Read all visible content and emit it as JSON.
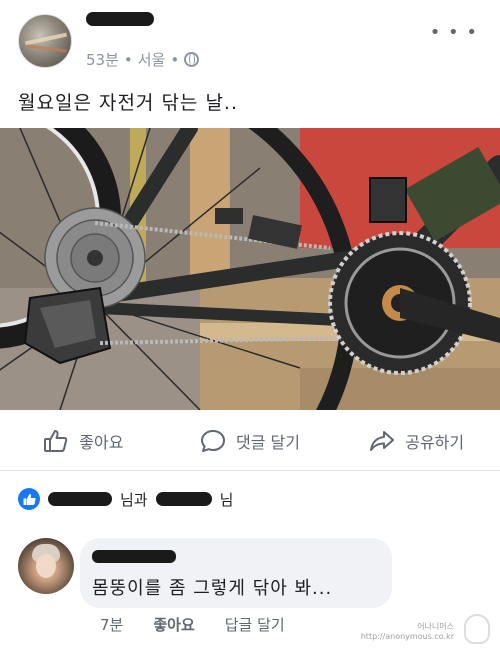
{
  "post": {
    "time": "53분",
    "location": "서울",
    "separator": "•",
    "text": "월요일은 자전거 닦는 날..",
    "more_icon": "more-horizontal-icon"
  },
  "actions": {
    "like": "좋아요",
    "comment": "댓글 달기",
    "share": "공유하기"
  },
  "reactions": {
    "name_suffix_1": "님과",
    "name_suffix_2": "님"
  },
  "comment": {
    "text": "몸뚱이를 좀 그렇게 닦아 봐...",
    "time": "7분",
    "like": "좋아요",
    "reply": "답글 달기"
  },
  "watermark": {
    "line1": "어나니머스",
    "line2": "http://anonymous.co.kr"
  },
  "colors": {
    "facebook_blue": "#1877f2",
    "meta_gray": "#8d949e",
    "bubble_gray": "#f0f2f5"
  }
}
